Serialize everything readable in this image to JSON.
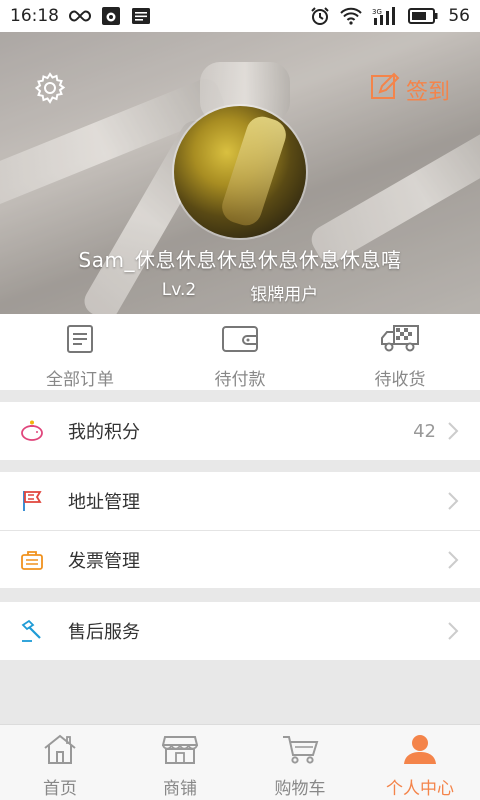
{
  "status_bar": {
    "time": "16:18",
    "battery": "56",
    "icons": [
      "infinity-icon",
      "bug-icon",
      "notification-icon",
      "alarm-icon",
      "wifi-icon",
      "signal-icon",
      "battery-icon"
    ],
    "signal_label": "3G"
  },
  "header": {
    "settings_icon": "gear-icon",
    "checkin_label": "签到",
    "checkin_icon": "edit-icon",
    "accent": "#f4844a",
    "username": "Sam_休息休息休息休息休息休息嘻",
    "level": "Lv.2",
    "member_type": "银牌用户"
  },
  "orders": [
    {
      "label": "全部订单",
      "icon": "document-icon"
    },
    {
      "label": "待付款",
      "icon": "wallet-icon"
    },
    {
      "label": "待收货",
      "icon": "truck-icon"
    }
  ],
  "menu": {
    "points": {
      "label": "我的积分",
      "value": "42",
      "icon": "piggy-bank-icon"
    },
    "address": {
      "label": "地址管理",
      "icon": "flag-icon"
    },
    "invoice": {
      "label": "发票管理",
      "icon": "briefcase-icon"
    },
    "after_sales": {
      "label": "售后服务",
      "icon": "hammer-icon"
    }
  },
  "bottom_nav": [
    {
      "label": "首页",
      "icon": "home-icon",
      "active": false
    },
    {
      "label": "商铺",
      "icon": "store-icon",
      "active": false
    },
    {
      "label": "购物车",
      "icon": "cart-icon",
      "active": false
    },
    {
      "label": "个人中心",
      "icon": "user-icon",
      "active": true
    }
  ]
}
